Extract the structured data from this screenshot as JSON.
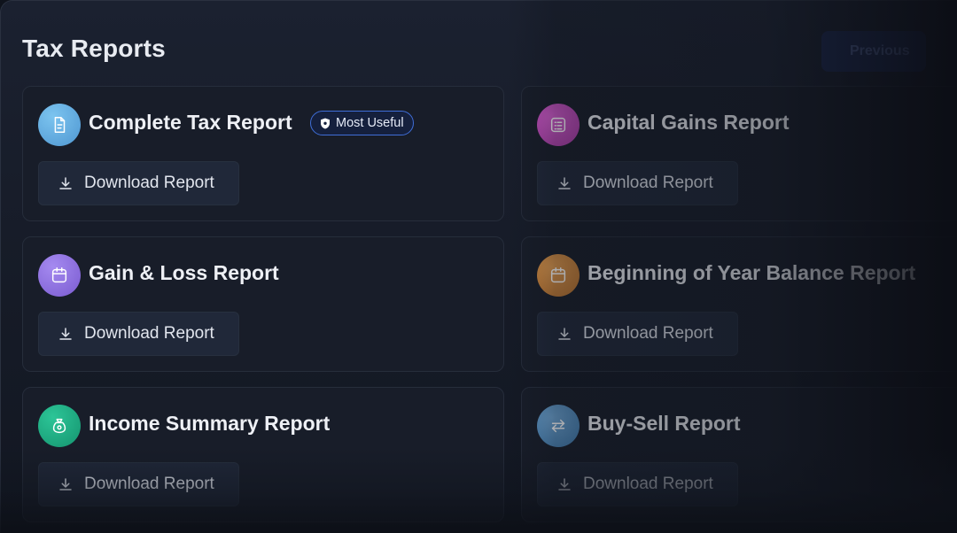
{
  "header": {
    "title": "Tax Reports",
    "previous_label": "Previous"
  },
  "cards": [
    {
      "title": "Complete Tax Report",
      "icon": "document-icon",
      "icon_color": "#5aa4d8",
      "badge": "Most Useful",
      "download_label": "Download Report"
    },
    {
      "title": "Capital Gains Report",
      "icon": "list-icon",
      "icon_color": "#b43fb0",
      "download_label": "Download Report"
    },
    {
      "title": "Gain & Loss Report",
      "icon": "calendar-icon",
      "icon_color": "#8a6ad8",
      "download_label": "Download Report"
    },
    {
      "title": "Beginning of Year Balance Report",
      "icon": "calendar-icon",
      "icon_color": "#c4803b",
      "download_label": "Download Report"
    },
    {
      "title": "Income Summary Report",
      "icon": "money-bag-icon",
      "icon_color": "#1aa37f",
      "download_label": "Download Report"
    },
    {
      "title": "Buy-Sell Report",
      "icon": "swap-arrows-icon",
      "icon_color": "#4f88b8",
      "download_label": "Download Report"
    }
  ],
  "colors": {
    "accent": "#3f6ed8",
    "background": "#0f131c",
    "card": "#181d29"
  }
}
